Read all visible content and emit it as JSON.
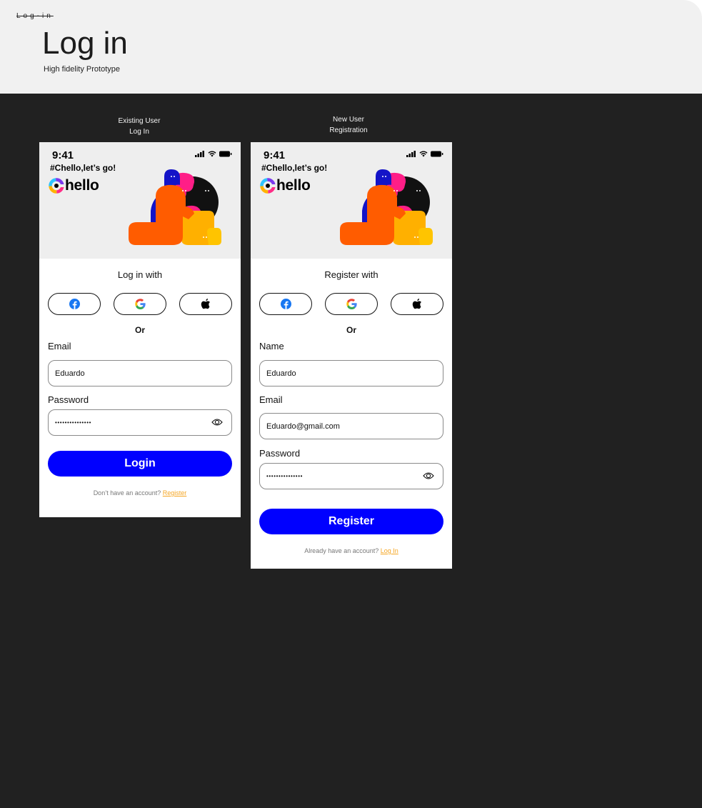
{
  "header": {
    "breadcrumb": "Log-in",
    "title": "Log in",
    "subtitle": "High fidelity Prototype"
  },
  "colors": {
    "primary": "#0000ff",
    "link": "#f5a623",
    "canvas": "#212121",
    "header_bg": "#f1f1f1"
  },
  "login_screen": {
    "caption_line1": "Existing User",
    "caption_line2": "Log In",
    "status_time": "9:41",
    "tagline": "#Chello,let’s go!",
    "brand": "hello",
    "heading": "Log in with",
    "or": "Or",
    "email_label": "Email",
    "email_value": "Eduardo",
    "password_label": "Password",
    "password_value": "•••••••••••••••",
    "button": "Login",
    "footer_text": "Don’t have an account?",
    "footer_link": "Register"
  },
  "register_screen": {
    "caption_line1": "New User",
    "caption_line2": "Registration",
    "status_time": "9:41",
    "tagline": "#Chello,let’s go!",
    "brand": "hello",
    "heading": "Register with",
    "or": "Or",
    "name_label": "Name",
    "name_value": "Eduardo",
    "email_label": "Email",
    "email_value": "Eduardo@gmail.com",
    "password_label": "Password",
    "password_value": "•••••••••••••••",
    "button": "Register",
    "footer_text": "Already have an account?",
    "footer_link": "Log In"
  },
  "icons": [
    "facebook-icon",
    "google-icon",
    "apple-icon",
    "eye-icon",
    "signal-icon",
    "wifi-icon",
    "battery-icon",
    "chello-logo-icon"
  ]
}
